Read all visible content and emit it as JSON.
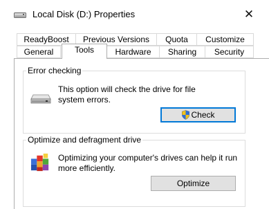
{
  "window": {
    "title": "Local Disk (D:) Properties",
    "close_glyph": "✕"
  },
  "tabs": {
    "row_top": [
      "ReadyBoost",
      "Previous Versions",
      "Quota",
      "Customize"
    ],
    "row_bottom": [
      "General",
      "Tools",
      "Hardware",
      "Sharing",
      "Security"
    ],
    "active": "Tools"
  },
  "error_checking": {
    "title": "Error checking",
    "description_line1": "This option will check the drive for file",
    "description_line2": "system errors.",
    "button_label": "Check",
    "icon": "drive-icon",
    "button_icon": "uac-shield-icon"
  },
  "optimize": {
    "title": "Optimize and defragment drive",
    "description_line1": "Optimizing your computer's drives can help it run",
    "description_line2": "more efficiently.",
    "button_label": "Optimize",
    "icon": "defragment-icon"
  },
  "colors": {
    "accent_border": "#0078d7",
    "button_face": "#e1e1e1"
  }
}
